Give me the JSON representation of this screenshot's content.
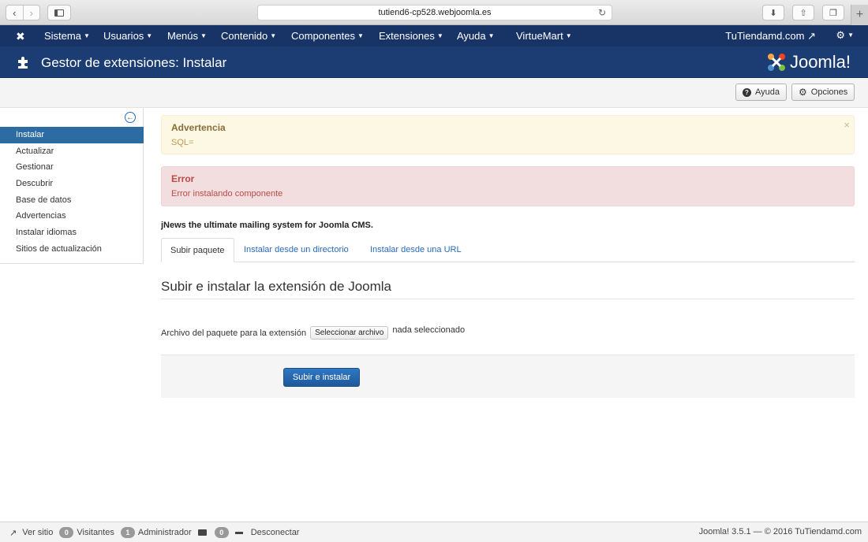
{
  "browser": {
    "url": "tutiend6-cp528.webjoomla.es"
  },
  "admin_nav": {
    "menus": [
      {
        "label": "Sistema"
      },
      {
        "label": "Usuarios"
      },
      {
        "label": "Menús"
      },
      {
        "label": "Contenido"
      },
      {
        "label": "Componentes"
      },
      {
        "label": "Extensiones"
      },
      {
        "label": "Ayuda"
      },
      {
        "label": "VirtueMart"
      }
    ],
    "site_name": "TuTiendamd.com"
  },
  "header": {
    "title": "Gestor de extensiones: Instalar",
    "brand": "Joomla!"
  },
  "toolbar": {
    "help_label": "Ayuda",
    "options_label": "Opciones"
  },
  "sidebar": {
    "items": [
      {
        "label": "Instalar",
        "active": true
      },
      {
        "label": "Actualizar"
      },
      {
        "label": "Gestionar"
      },
      {
        "label": "Descubrir"
      },
      {
        "label": "Base de datos"
      },
      {
        "label": "Advertencias"
      },
      {
        "label": "Instalar idiomas"
      },
      {
        "label": "Sitios de actualización"
      }
    ]
  },
  "alerts": {
    "warning": {
      "heading": "Advertencia",
      "message": "SQL=",
      "close": "×"
    },
    "error": {
      "heading": "Error",
      "message": "Error instalando componente"
    }
  },
  "main": {
    "extension_description": "jNews the ultimate mailing system for Joomla CMS.",
    "tabs": [
      {
        "label": "Subir paquete",
        "active": true
      },
      {
        "label": "Instalar desde un directorio"
      },
      {
        "label": "Instalar desde una URL"
      }
    ],
    "section_title": "Subir e instalar la extensión de Joomla",
    "file_label": "Archivo del paquete para la extensión",
    "file_button": "Seleccionar archivo",
    "file_status": "nada seleccionado",
    "submit_label": "Subir e instalar"
  },
  "status_bar": {
    "view_site": "Ver sitio",
    "visitors_count": "0",
    "visitors_label": "Visitantes",
    "admins_count": "1",
    "admins_label": "Administrador",
    "messages_count": "0",
    "logout": "Desconectar",
    "footer": "Joomla! 3.5.1  —  © 2016 TuTiendamd.com"
  }
}
